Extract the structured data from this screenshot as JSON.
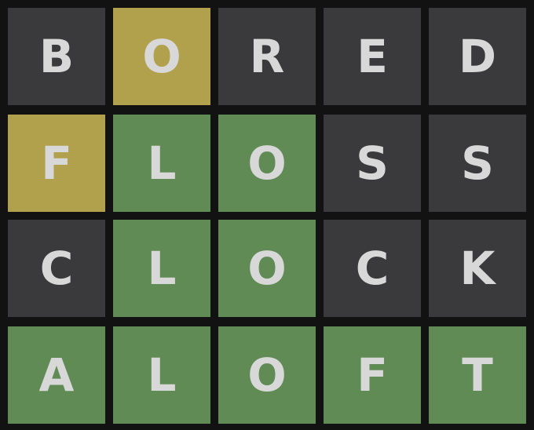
{
  "colors": {
    "background": "#121213",
    "absent": "#3a3a3c",
    "present": "#b1a04c",
    "correct": "#608b55",
    "letter": "#d8d8d8"
  },
  "board": {
    "rows": [
      {
        "word": "BORED",
        "tiles": [
          {
            "letter": "B",
            "state": "absent"
          },
          {
            "letter": "O",
            "state": "present"
          },
          {
            "letter": "R",
            "state": "absent"
          },
          {
            "letter": "E",
            "state": "absent"
          },
          {
            "letter": "D",
            "state": "absent"
          }
        ]
      },
      {
        "word": "FLOSS",
        "tiles": [
          {
            "letter": "F",
            "state": "present"
          },
          {
            "letter": "L",
            "state": "correct"
          },
          {
            "letter": "O",
            "state": "correct"
          },
          {
            "letter": "S",
            "state": "absent"
          },
          {
            "letter": "S",
            "state": "absent"
          }
        ]
      },
      {
        "word": "CLOCK",
        "tiles": [
          {
            "letter": "C",
            "state": "absent"
          },
          {
            "letter": "L",
            "state": "correct"
          },
          {
            "letter": "O",
            "state": "correct"
          },
          {
            "letter": "C",
            "state": "absent"
          },
          {
            "letter": "K",
            "state": "absent"
          }
        ]
      },
      {
        "word": "ALOFT",
        "tiles": [
          {
            "letter": "A",
            "state": "correct"
          },
          {
            "letter": "L",
            "state": "correct"
          },
          {
            "letter": "O",
            "state": "correct"
          },
          {
            "letter": "F",
            "state": "correct"
          },
          {
            "letter": "T",
            "state": "correct"
          }
        ]
      }
    ]
  }
}
